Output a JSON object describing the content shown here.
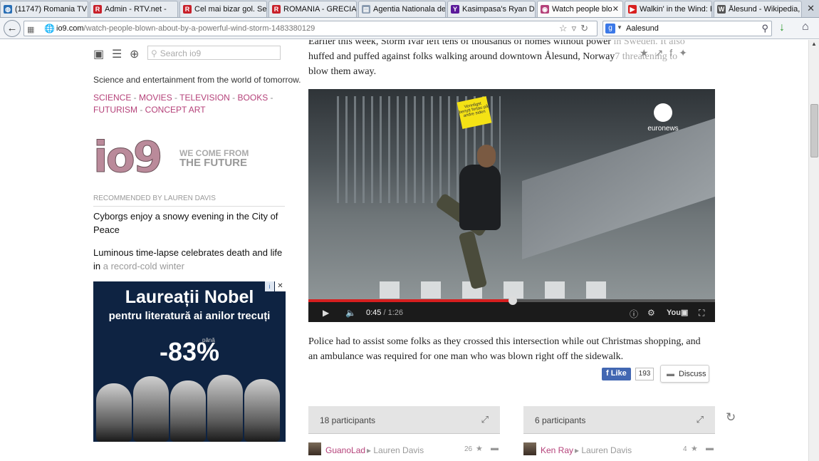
{
  "browser": {
    "tabs": [
      {
        "label": "(11747) Romania TV ...",
        "icon": "globe-icon",
        "icon_color": "#2a6fb5"
      },
      {
        "label": "Admin - RTV.net -",
        "icon": "r-logo-icon",
        "icon_color": "#c8202a"
      },
      {
        "label": "Cel mai bizar gol. Se ...",
        "icon": "r-logo-icon",
        "icon_color": "#c8202a"
      },
      {
        "label": "ROMANIA - GRECIA. ...",
        "icon": "r-logo-icon",
        "icon_color": "#c8202a"
      },
      {
        "label": "Agentia Nationala de ...",
        "icon": "page-icon",
        "icon_color": "#8a9bb0"
      },
      {
        "label": "Kasimpasa's Ryan Do...",
        "icon": "yahoo-icon",
        "icon_color": "#5b1a9a"
      },
      {
        "label": "Watch people blo...",
        "icon": "io9-icon",
        "icon_color": "#b5427a",
        "active": true
      },
      {
        "label": "Walkin' in the Wind: P...",
        "icon": "youtube-icon",
        "icon_color": "#d81f1f"
      },
      {
        "label": "Ålesund - Wikipedia, ...",
        "icon": "wikipedia-icon",
        "icon_color": "#555555"
      }
    ],
    "close_all": "✕",
    "url_host": "io9.com",
    "url_path": "/watch-people-blown-about-by-a-powerful-wind-storm-1483380129",
    "search_value": "Aalesund"
  },
  "sidebar": {
    "search_placeholder": "Search io9",
    "tagline": "Science and entertainment from the world of tomorrow.",
    "categories": [
      "SCIENCE",
      "MOVIES",
      "TELEVISION",
      "BOOKS",
      "FUTURISM",
      "CONCEPT ART"
    ],
    "logo_text": "io9",
    "logo_tag_1": "WE COME FROM",
    "logo_tag_2": "THE FUTURE",
    "recommended_label": "RECOMMENDED BY LAUREN DAVIS",
    "recommended": [
      {
        "title": "Cyborgs enjoy a snowy evening in the City of Peace"
      },
      {
        "title_main": "Luminous time-lapse celebrates death and life in",
        "title_faded": "a record-cold winter"
      }
    ]
  },
  "ad": {
    "headline": "Laureații Nobel",
    "subline": "pentru literatură ai anilor trecuți",
    "discount": "-83%",
    "discount_small": "până",
    "info": "i",
    "close": "✕"
  },
  "article": {
    "intro_partial": "Earlier this week, Storm Ivar left tens of thousands of homes without power",
    "intro_faint": "in Sweden. It also",
    "intro_line2": "huffed and puffed against folks walking around downtown Ålesund, Norway",
    "intro_faint2": "7 threatening",
    "intro_line3_faint": "to",
    "intro_line3": "blow them away.",
    "body": "Police had to assist some folks as they crossed this intersection while out Christmas shopping, and an ambulance was required for one man who was blown right off the sidewalk.",
    "like_label": "Like",
    "like_count": "193",
    "discuss_label": "Discuss"
  },
  "video": {
    "current_time": "0:45",
    "duration": "1:26",
    "progress": 0.523,
    "channel": "euronews",
    "sign_text": "Vennligst benytt fortau på andre siden"
  },
  "discussions": [
    {
      "participants": "18 participants",
      "user": "GuanoLad",
      "to": "Lauren Davis",
      "count": "26"
    },
    {
      "participants": "6 participants",
      "user": "Ken Ray",
      "to": "Lauren Davis",
      "count": "4"
    }
  ]
}
